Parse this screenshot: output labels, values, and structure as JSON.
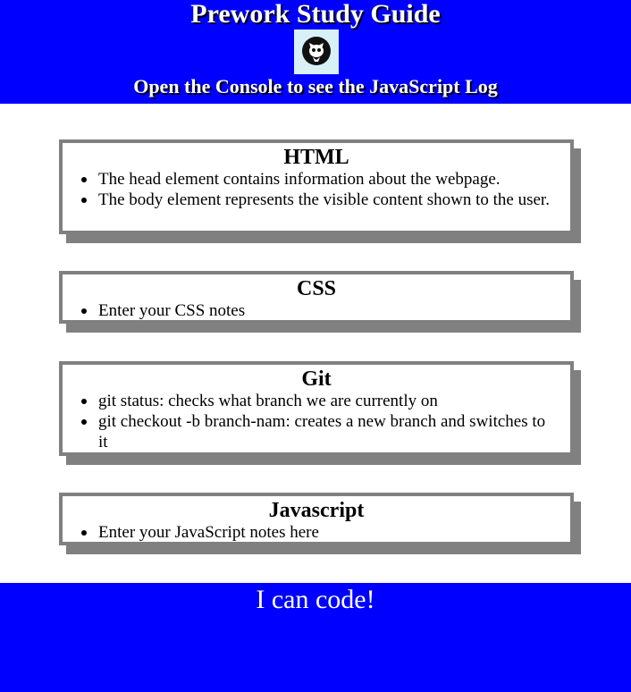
{
  "header": {
    "title": "Prework Study Guide",
    "logo_icon": "cat-skull-icon",
    "subtitle": "Open the Console to see the JavaScript Log"
  },
  "sections": [
    {
      "title": "HTML",
      "items": [
        "The head element contains information about the webpage.",
        "The body element represents the visible content shown to the user."
      ]
    },
    {
      "title": "CSS",
      "items": [
        "Enter your CSS notes"
      ]
    },
    {
      "title": "Git",
      "items": [
        "git status: checks what branch we are currently on",
        "git checkout -b branch-nam: creates a new branch and switches to it"
      ]
    },
    {
      "title": "Javascript",
      "items": [
        "Enter your JavaScript notes here"
      ]
    }
  ],
  "footer": {
    "text": "I can code!"
  },
  "colors": {
    "header_bg": "#0000ff",
    "footer_bg": "#0000ff",
    "card_border": "#808080",
    "logo_bg": "#d7f1f7"
  }
}
